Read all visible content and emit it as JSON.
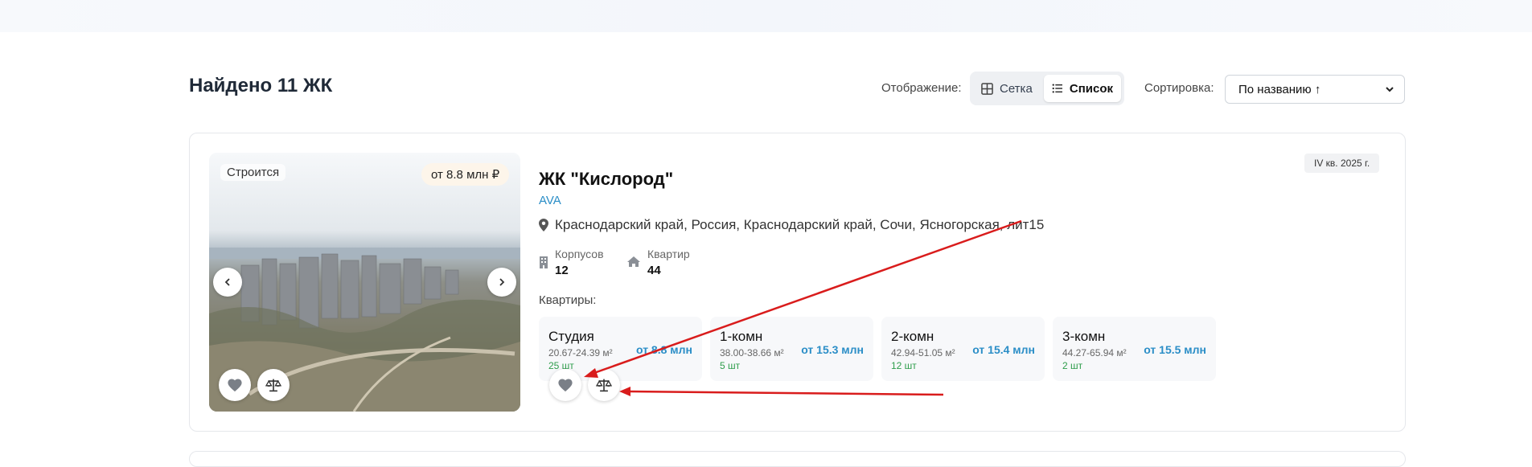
{
  "header": {
    "found_title": "Найдено 11 ЖК"
  },
  "view": {
    "label": "Отображение:",
    "grid_label": "Сетка",
    "list_label": "Список",
    "active": "list"
  },
  "sort": {
    "label": "Сортировка:",
    "selected": "По названию ↑"
  },
  "complex": {
    "status": "Строится",
    "price_badge": "от 8.8 млн ₽",
    "completion": "IV кв. 2025 г.",
    "name": "ЖК \"Кислород\"",
    "developer": "AVA",
    "address": "Краснодарский край, Россия, Краснодарский край, Сочи, Ясногорская, лит15",
    "buildings_label": "Корпусов",
    "buildings_value": "12",
    "apartments_label": "Квартир",
    "apartments_value": "44",
    "apartments_section_label": "Квартиры:",
    "apartments": [
      {
        "type": "Студия",
        "area": "20.67-24.39 м²",
        "price": "от 8.8 млн",
        "count": "25 шт"
      },
      {
        "type": "1-комн",
        "area": "38.00-38.66 м²",
        "price": "от 15.3 млн",
        "count": "5 шт"
      },
      {
        "type": "2-комн",
        "area": "42.94-51.05 м²",
        "price": "от 15.4 млн",
        "count": "12 шт"
      },
      {
        "type": "3-комн",
        "area": "44.27-65.94 м²",
        "price": "от 15.5 млн",
        "count": "2 шт"
      }
    ]
  },
  "colors": {
    "accent": "#2b8ec7",
    "count_green": "#2e9d4b",
    "annotation_red": "#d91c1c"
  },
  "icons": [
    "grid-icon",
    "list-icon",
    "chevron-down-icon",
    "chevron-left-icon",
    "chevron-right-icon",
    "heart-icon",
    "scales-icon",
    "map-pin-icon",
    "building-icon",
    "house-icon"
  ]
}
